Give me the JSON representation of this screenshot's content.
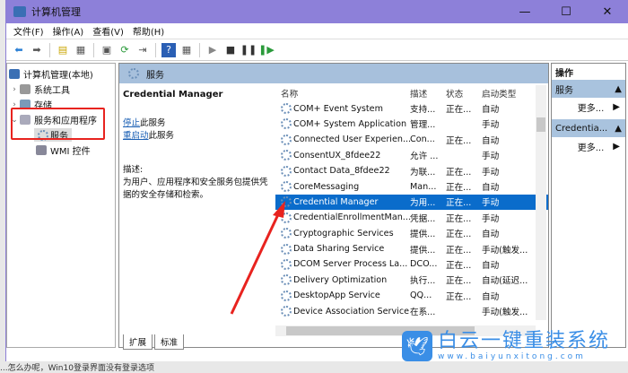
{
  "window": {
    "title": "计算机管理",
    "controls": [
      "—",
      "☐",
      "✕"
    ]
  },
  "menu": [
    "文件(F)",
    "操作(A)",
    "查看(V)",
    "帮助(H)"
  ],
  "tree": {
    "root": "计算机管理(本地)",
    "items": [
      "系统工具",
      "存储",
      "服务和应用程序"
    ],
    "sub": [
      "服务",
      "WMI 控件"
    ]
  },
  "panel": {
    "header": "服务",
    "service_name": "Credential Manager",
    "stop_link": "停止",
    "stop_rest": "此服务",
    "restart_link": "重启动",
    "restart_rest": "此服务",
    "desc_label": "描述:",
    "desc": "为用户、应用程序和安全服务包提供凭据的安全存储和检索。"
  },
  "columns": [
    "名称",
    "描述",
    "状态",
    "启动类型"
  ],
  "rows": [
    [
      "COM+ Event System",
      "支持...",
      "正在...",
      "自动"
    ],
    [
      "COM+ System Application",
      "管理...",
      "",
      "手动"
    ],
    [
      "Connected User Experien...",
      "Con...",
      "正在...",
      "自动"
    ],
    [
      "ConsentUX_8fdee22",
      "允许 ...",
      "",
      "手动"
    ],
    [
      "Contact Data_8fdee22",
      "为联...",
      "正在...",
      "手动"
    ],
    [
      "CoreMessaging",
      "Man...",
      "正在...",
      "自动"
    ],
    [
      "Credential Manager",
      "为用...",
      "正在...",
      "手动"
    ],
    [
      "CredentialEnrollmentMan...",
      "凭据...",
      "正在...",
      "手动"
    ],
    [
      "Cryptographic Services",
      "提供...",
      "正在...",
      "自动"
    ],
    [
      "Data Sharing Service",
      "提供...",
      "正在...",
      "手动(触发..."
    ],
    [
      "DCOM Server Process La...",
      "DCO...",
      "正在...",
      "自动"
    ],
    [
      "Delivery Optimization",
      "执行...",
      "正在...",
      "自动(延迟..."
    ],
    [
      "DesktopApp Service",
      "QQ...",
      "正在...",
      "自动"
    ],
    [
      "Device Association Service",
      "在系...",
      "",
      "手动(触发..."
    ]
  ],
  "tabs": [
    "扩展",
    "标准"
  ],
  "actions": {
    "title": "操作",
    "sections": [
      {
        "label": "服务",
        "more": "更多..."
      },
      {
        "label": "Credentia...",
        "more": "更多..."
      }
    ]
  },
  "watermark": {
    "name": "白云一键重装系统",
    "url": "www.baiyunxitong.com"
  },
  "bottom_text": "...怎么办呢，Win10登录界面没有登录选项"
}
